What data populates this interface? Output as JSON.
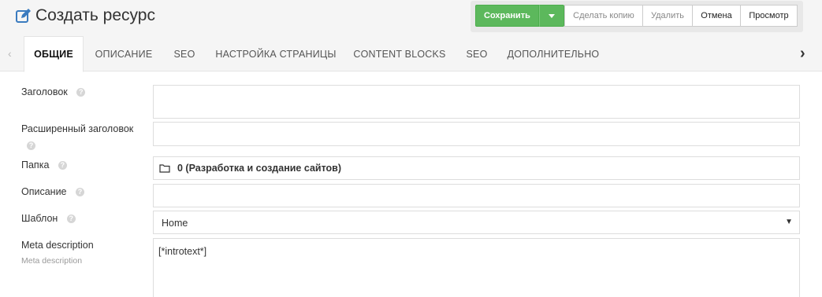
{
  "header": {
    "title": "Создать ресурс",
    "title_icon": "edit-icon"
  },
  "toolbar": {
    "save_label": "Сохранить",
    "copy_label": "Сделать копию",
    "delete_label": "Удалить",
    "cancel_label": "Отмена",
    "preview_label": "Просмотр"
  },
  "tabs": [
    {
      "label": "ОБЩИЕ",
      "active": true
    },
    {
      "label": "ОПИСАНИЕ"
    },
    {
      "label": "SEO"
    },
    {
      "label": "НАСТРОЙКА СТРАНИЦЫ"
    },
    {
      "label": "CONTENT BLOCKS"
    },
    {
      "label": "SEO"
    },
    {
      "label": "ДОПОЛНИТЕЛЬНО"
    }
  ],
  "tab_nav": {
    "left_glyph": "‹",
    "right_glyph": "›"
  },
  "form": {
    "pagetitle": {
      "label": "Заголовок",
      "value": ""
    },
    "longtitle": {
      "label": "Расширенный заголовок",
      "value": ""
    },
    "parent": {
      "label": "Папка",
      "value": "0 (Разработка и создание сайтов)"
    },
    "description": {
      "label": "Описание",
      "value": ""
    },
    "template": {
      "label": "Шаблон",
      "value": "Home"
    },
    "meta_description": {
      "label": "Meta description",
      "sub_label": "Meta description",
      "value": "[*introtext*]"
    }
  },
  "help_glyph": "?",
  "colors": {
    "save_green": "#5cb85c",
    "header_bg": "#f5f5f5",
    "border": "#dddddd"
  }
}
